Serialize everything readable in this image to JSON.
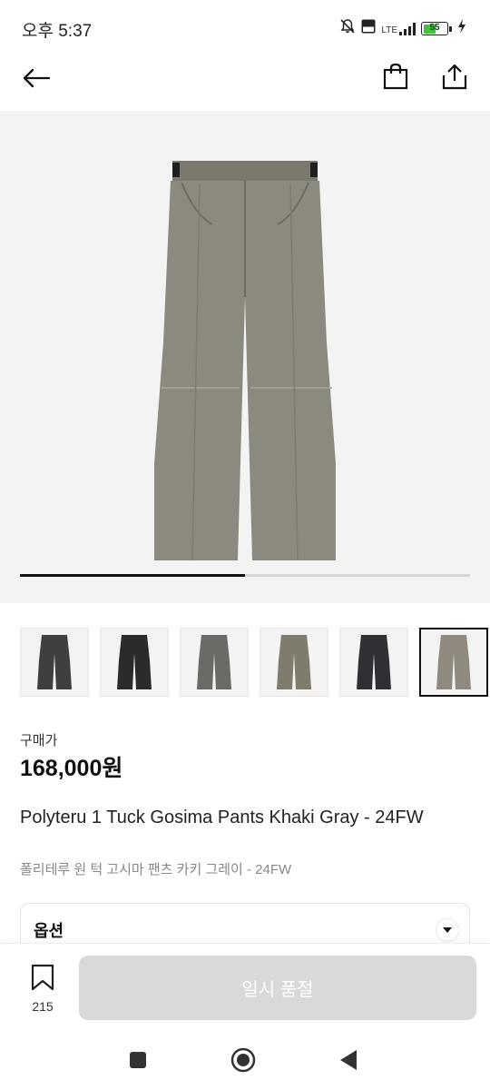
{
  "status_bar": {
    "time": "오후 5:37",
    "lte_label": "LTE",
    "battery_level": "55",
    "icons": [
      "mute-bell-icon",
      "volte-icon",
      "lte-signal-icon",
      "battery-icon",
      "charging-bolt-icon"
    ]
  },
  "header": {
    "icons": [
      "back-arrow-icon",
      "shopping-bag-icon",
      "share-icon"
    ]
  },
  "gallery": {
    "image_progress": 0.5,
    "selected_index": 5,
    "thumbnail_colors": [
      "#3f3f3f",
      "#2b2b2b",
      "#6c6a66",
      "#7f7c6e",
      "#2f3033",
      "#8f8a7d"
    ],
    "main_color": "#8c8a7e"
  },
  "product": {
    "price_label": "구매가",
    "price": "168,000원",
    "title": "Polyteru 1 Tuck Gosima Pants Khaki Gray - 24FW",
    "subtitle": "폴리테루 원 턱 고시마 팬츠 카키 그레이 - 24FW"
  },
  "option": {
    "label": "옵션",
    "icon": "chevron-down-icon"
  },
  "bottom_bar": {
    "bookmark_count": "215",
    "soldout_label": "일시 품절",
    "soldout_bg": "#d9d9d9"
  },
  "nav_bar": {
    "icons": [
      "recents-square-icon",
      "home-circle-icon",
      "back-triangle-icon"
    ]
  }
}
